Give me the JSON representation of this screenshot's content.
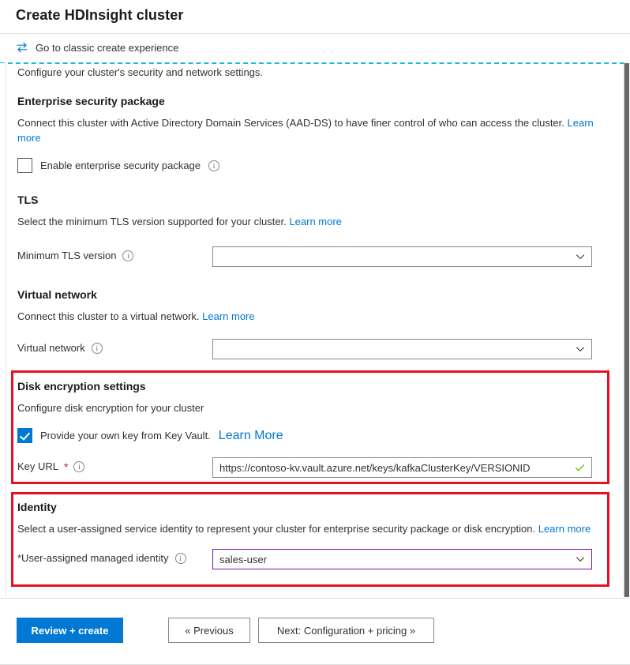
{
  "window": {
    "title": "Create HDInsight cluster"
  },
  "command_bar": {
    "classic_link": "Go to classic create experience",
    "icon": "swap-arrows-icon"
  },
  "intro": {
    "text": "Configure your cluster's security and network settings."
  },
  "enterprise_security": {
    "heading": "Enterprise security package",
    "description": "Connect this cluster with Active Directory Domain Services (AAD-DS) to have finer control of who can access the cluster.",
    "learn_more": "Learn more",
    "checkbox_label": "Enable enterprise security package",
    "checkbox_checked": false,
    "info_icon": "info-icon"
  },
  "tls": {
    "heading": "TLS",
    "description": "Select the minimum TLS version supported for your cluster.",
    "learn_more": "Learn more",
    "field_label": "Minimum TLS version",
    "value": "",
    "info_icon": "info-icon",
    "chevron_icon": "chevron-down-icon"
  },
  "virtual_network": {
    "heading": "Virtual network",
    "description": "Connect this cluster to a virtual network.",
    "learn_more": "Learn more",
    "field_label": "Virtual network",
    "value": "",
    "info_icon": "info-icon",
    "chevron_icon": "chevron-down-icon"
  },
  "disk_encryption": {
    "heading": "Disk encryption settings",
    "description": "Configure disk encryption for your cluster",
    "checkbox_label": "Provide your own key from Key Vault.",
    "checkbox_checked": true,
    "learn_more": "Learn More",
    "field_label": "Key URL",
    "required_marker": "*",
    "value": "https://contoso-kv.vault.azure.net/keys/kafkaClusterKey/VERSIONID",
    "valid_icon": "green-check-icon",
    "info_icon": "info-icon",
    "highlight_color": "#e81123"
  },
  "identity": {
    "heading": "Identity",
    "description": "Select a user-assigned service identity to represent your cluster for enterprise security package or disk encryption.",
    "learn_more": "Learn more",
    "field_label": "*User-assigned managed identity",
    "value": "sales-user",
    "info_icon": "info-icon",
    "chevron_icon": "chevron-down-icon",
    "border_color": "#7719aa",
    "highlight_color": "#e81123"
  },
  "footer": {
    "review_create": "Review + create",
    "previous": "« Previous",
    "next": "Next: Configuration + pricing »"
  },
  "colors": {
    "accent_blue": "#0078d4",
    "link_blue": "#0078d4",
    "highlight_red": "#e81123",
    "dashed_divider": "#19b9e0",
    "purple_border": "#7719aa",
    "green_check": "#6bb700"
  }
}
